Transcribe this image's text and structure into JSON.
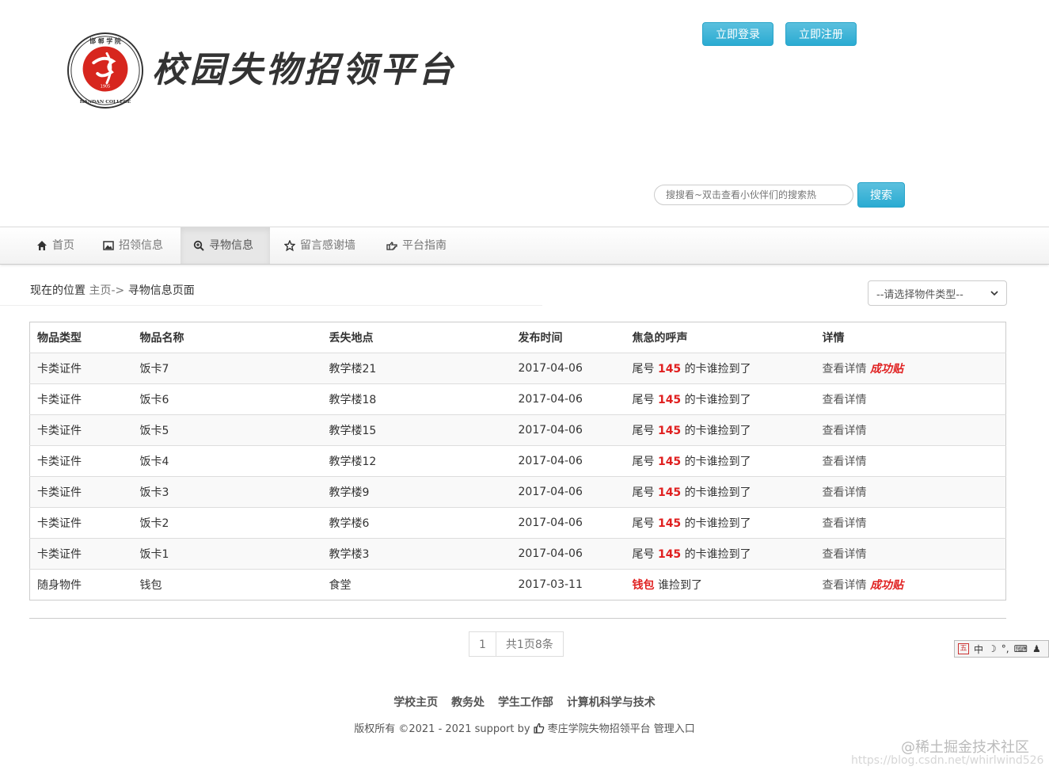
{
  "header": {
    "site_title": "校园失物招领平台",
    "logo_text_top": "邯郸学院",
    "logo_text_bottom": "HANDAN COLLEGE",
    "logo_year": "1905",
    "login_label": "立即登录",
    "register_label": "立即注册"
  },
  "search": {
    "placeholder": "搜搜看~双击查看小伙伴们的搜索热",
    "button_label": "搜索"
  },
  "nav": {
    "items": [
      {
        "label": "首页",
        "icon": "home-icon"
      },
      {
        "label": "招领信息",
        "icon": "picture-icon"
      },
      {
        "label": "寻物信息",
        "icon": "zoom-in-icon",
        "active": true
      },
      {
        "label": "留言感谢墙",
        "icon": "star-icon"
      },
      {
        "label": "平台指南",
        "icon": "hand-right-icon"
      }
    ]
  },
  "breadcrumb": {
    "prefix": "现在的位置",
    "home": "主页->",
    "current": "寻物信息页面"
  },
  "filter": {
    "selected": "--请选择物件类型--"
  },
  "table": {
    "headers": [
      "物品类型",
      "物品名称",
      "丢失地点",
      "发布时间",
      "焦急的呼声",
      "详情"
    ],
    "rows": [
      {
        "type": "卡类证件",
        "name": "饭卡7",
        "place": "教学楼21",
        "date": "2017-04-06",
        "voice_pre": "尾号 ",
        "voice_hl": "145",
        "voice_post": " 的卡谁捡到了",
        "detail": "查看详情",
        "success": "成功贴"
      },
      {
        "type": "卡类证件",
        "name": "饭卡6",
        "place": "教学楼18",
        "date": "2017-04-06",
        "voice_pre": "尾号 ",
        "voice_hl": "145",
        "voice_post": " 的卡谁捡到了",
        "detail": "查看详情",
        "success": ""
      },
      {
        "type": "卡类证件",
        "name": "饭卡5",
        "place": "教学楼15",
        "date": "2017-04-06",
        "voice_pre": "尾号 ",
        "voice_hl": "145",
        "voice_post": " 的卡谁捡到了",
        "detail": "查看详情",
        "success": ""
      },
      {
        "type": "卡类证件",
        "name": "饭卡4",
        "place": "教学楼12",
        "date": "2017-04-06",
        "voice_pre": "尾号 ",
        "voice_hl": "145",
        "voice_post": " 的卡谁捡到了",
        "detail": "查看详情",
        "success": ""
      },
      {
        "type": "卡类证件",
        "name": "饭卡3",
        "place": "教学楼9",
        "date": "2017-04-06",
        "voice_pre": "尾号 ",
        "voice_hl": "145",
        "voice_post": " 的卡谁捡到了",
        "detail": "查看详情",
        "success": ""
      },
      {
        "type": "卡类证件",
        "name": "饭卡2",
        "place": "教学楼6",
        "date": "2017-04-06",
        "voice_pre": "尾号 ",
        "voice_hl": "145",
        "voice_post": " 的卡谁捡到了",
        "detail": "查看详情",
        "success": ""
      },
      {
        "type": "卡类证件",
        "name": "饭卡1",
        "place": "教学楼3",
        "date": "2017-04-06",
        "voice_pre": "尾号 ",
        "voice_hl": "145",
        "voice_post": " 的卡谁捡到了",
        "detail": "查看详情",
        "success": ""
      },
      {
        "type": "随身物件",
        "name": "钱包",
        "place": "食堂",
        "date": "2017-03-11",
        "voice_pre": "",
        "voice_hl": "钱包",
        "voice_post": " 谁捡到了",
        "detail": "查看详情",
        "success": "成功贴"
      }
    ]
  },
  "pagination": {
    "current_page": "1",
    "summary": "共1页8条"
  },
  "ime": {
    "mode": "中"
  },
  "footer": {
    "links": [
      "学校主页",
      "教务处",
      "学生工作部",
      "计算机科学与技术"
    ],
    "copyright_pre": "版权所有 ©2021 - 2021 support by",
    "copyright_post": "枣庄学院失物招领平台 管理入口"
  },
  "watermark": {
    "text": "@稀土掘金技术社区",
    "url_text": "https://blog.csdn.net/whirlwind526"
  },
  "colors": {
    "accent": "#5bc0de",
    "highlight": "#e02020",
    "logo_red": "#d7261e"
  }
}
